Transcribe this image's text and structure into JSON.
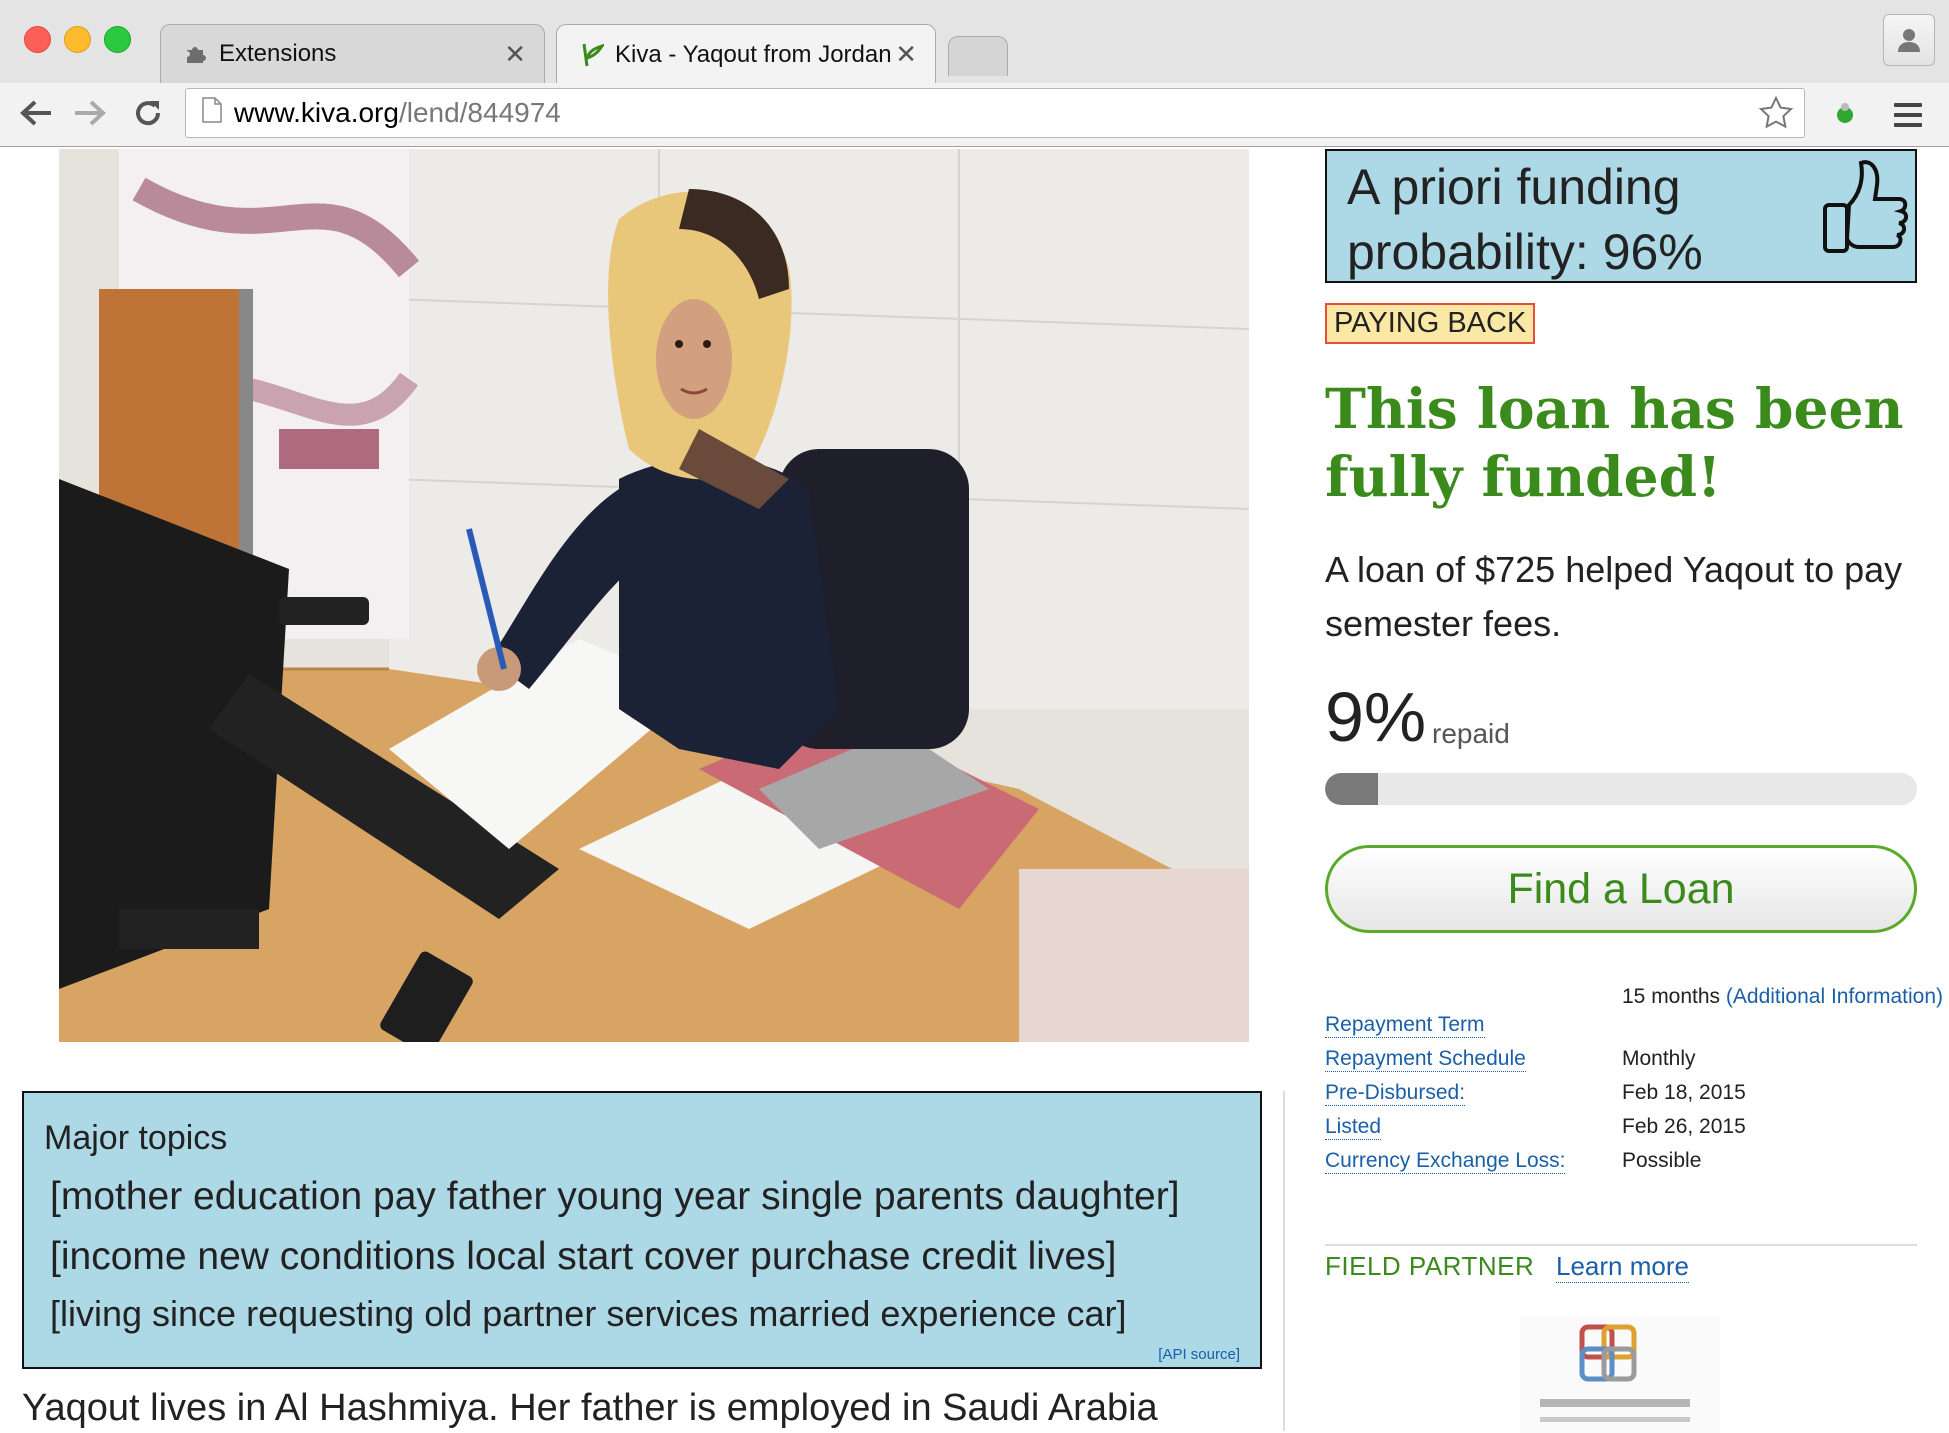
{
  "browser": {
    "tabs": [
      {
        "label": "Extensions",
        "icon": "puzzle-icon"
      },
      {
        "label": "Kiva - Yaqout from Jordan",
        "icon": "kiva-leaf-icon"
      }
    ],
    "url": {
      "host": "www.kiva.org",
      "path": "/lend/844974"
    }
  },
  "probability_box": {
    "text": "A priori funding probability: 96%",
    "icon": "thumbs-up-icon"
  },
  "status_badge": "PAYING BACK",
  "funded_title": "This loan has been fully funded!",
  "loan_description": "A loan of $725 helped Yaqout to pay semester fees.",
  "repayment": {
    "percent_text": "9%",
    "label": "repaid",
    "fraction": 0.09
  },
  "find_loan_button": "Find a Loan",
  "details": [
    {
      "label": "Repayment Term",
      "value": "15 months",
      "link": "(Additional Information)"
    },
    {
      "label": "Repayment Schedule",
      "value": "Monthly"
    },
    {
      "label": "Pre-Disbursed:",
      "value": "Feb 18, 2015"
    },
    {
      "label": "Listed",
      "value": "Feb 26, 2015"
    },
    {
      "label": "Currency Exchange Loss:",
      "value": "Possible"
    }
  ],
  "field_partner": {
    "heading": "FIELD PARTNER",
    "learn_more": "Learn more"
  },
  "topics_box": {
    "title": "Major topics",
    "lines": [
      "[mother education pay father young year single parents daughter]",
      "[income new conditions local start cover purchase credit lives]",
      "[living since requesting old partner services married experience car]"
    ],
    "source": "[API source]"
  },
  "story_text": "Yaqout lives in Al Hashmiya. Her father is employed in Saudi Arabia",
  "colors": {
    "kiva_green": "#3b8a1c",
    "box_blue": "#add8e6",
    "link_blue": "#1a5fa8",
    "badge_bg": "#fbe8a4",
    "badge_border": "#e74c3c"
  }
}
